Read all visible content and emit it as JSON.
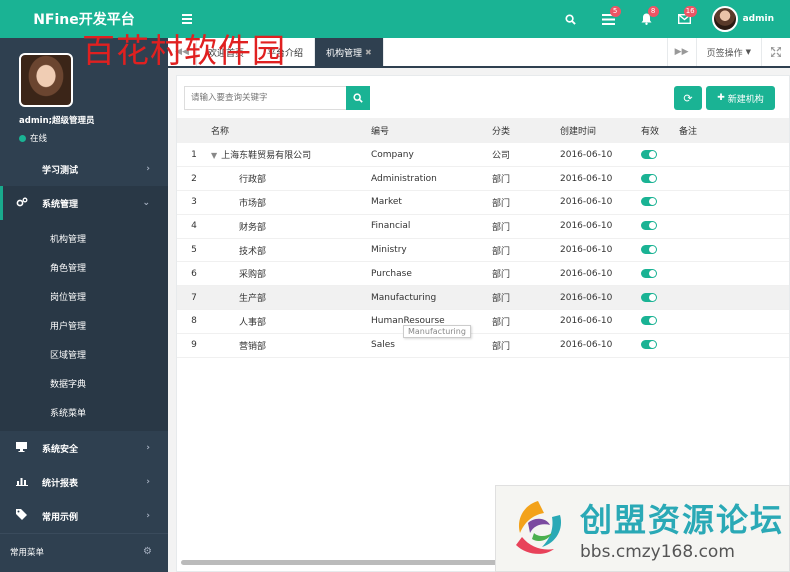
{
  "brand": "NFine开发平台",
  "header": {
    "badges": {
      "tasks": "5",
      "alerts": "8",
      "messages": "16"
    },
    "username": "admin"
  },
  "profile": {
    "name": "admin;超级管理员",
    "status": "在线",
    "watermark": "百花村软件园"
  },
  "sidebar": {
    "items": [
      {
        "icon": "",
        "label": "学习测试"
      },
      {
        "icon": "gears-icon",
        "label": "系统管理"
      },
      {
        "icon": "monitor-icon",
        "label": "系统安全"
      },
      {
        "icon": "bar-chart-icon",
        "label": "统计报表"
      },
      {
        "icon": "tag-icon",
        "label": "常用示例"
      }
    ],
    "sub_items": [
      "机构管理",
      "角色管理",
      "岗位管理",
      "用户管理",
      "区域管理",
      "数据字典",
      "系统菜单"
    ],
    "common_menu": "常用菜单"
  },
  "tabs": {
    "items": [
      "欢迎首页",
      "平台介绍",
      "机构管理"
    ],
    "ops_label": "页签操作"
  },
  "toolbar": {
    "search_placeholder": "请输入要查询关键字",
    "new_label": "新建机构"
  },
  "table": {
    "headers": [
      "名称",
      "编号",
      "分类",
      "创建时间",
      "有效",
      "备注"
    ],
    "rows": [
      {
        "idx": "1",
        "name": "上海东鞋贸易有限公司",
        "code": "Company",
        "cat": "公司",
        "date": "2016-06-10"
      },
      {
        "idx": "2",
        "name": "行政部",
        "code": "Administration",
        "cat": "部门",
        "date": "2016-06-10"
      },
      {
        "idx": "3",
        "name": "市场部",
        "code": "Market",
        "cat": "部门",
        "date": "2016-06-10"
      },
      {
        "idx": "4",
        "name": "财务部",
        "code": "Financial",
        "cat": "部门",
        "date": "2016-06-10"
      },
      {
        "idx": "5",
        "name": "技术部",
        "code": "Ministry",
        "cat": "部门",
        "date": "2016-06-10"
      },
      {
        "idx": "6",
        "name": "采购部",
        "code": "Purchase",
        "cat": "部门",
        "date": "2016-06-10"
      },
      {
        "idx": "7",
        "name": "生产部",
        "code": "Manufacturing",
        "cat": "部门",
        "date": "2016-06-10"
      },
      {
        "idx": "8",
        "name": "人事部",
        "code": "HumanResourse",
        "cat": "部门",
        "date": "2016-06-10"
      },
      {
        "idx": "9",
        "name": "营销部",
        "code": "Sales",
        "cat": "部门",
        "date": "2016-06-10"
      }
    ],
    "tooltip": "Manufacturing"
  },
  "forum_watermark": {
    "name": "创盟资源论坛",
    "url": "bbs.cmzy168.com"
  },
  "colors": {
    "accent": "#1ab394",
    "sidebar": "#2f4050",
    "badge": "#ed5565",
    "watermark": "#e02020"
  }
}
